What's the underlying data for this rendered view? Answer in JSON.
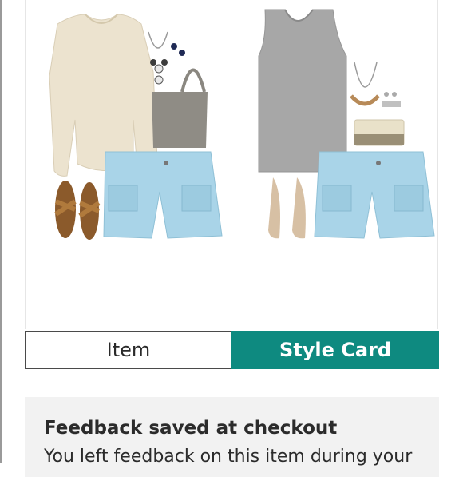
{
  "segmented_control": {
    "item_label": "Item",
    "style_card_label": "Style Card",
    "selected": "Style Card",
    "accent_color": "#0e8a80"
  },
  "feedback": {
    "title": "Feedback saved at checkout",
    "body": "You left feedback on this item during your"
  },
  "style_card": {
    "outfits": [
      {
        "items": [
          "sweater",
          "necklace",
          "earrings",
          "tote-bag",
          "cargo-shorts",
          "sandals"
        ]
      },
      {
        "items": [
          "tank-top",
          "necklace",
          "earrings",
          "clutch",
          "cargo-shorts",
          "flats"
        ]
      }
    ]
  }
}
